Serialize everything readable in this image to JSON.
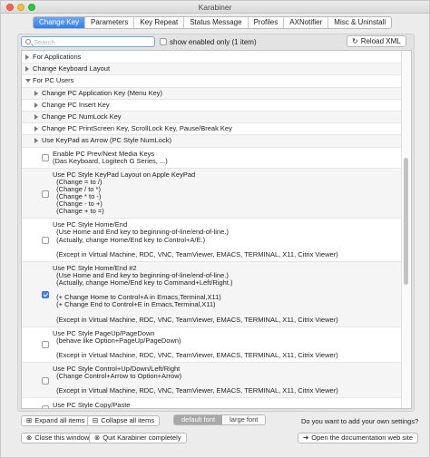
{
  "window": {
    "title": "Karabiner"
  },
  "tabs": [
    {
      "label": "Change Key",
      "active": true
    },
    {
      "label": "Parameters",
      "active": false
    },
    {
      "label": "Key Repeat",
      "active": false
    },
    {
      "label": "Status Message",
      "active": false
    },
    {
      "label": "Profiles",
      "active": false
    },
    {
      "label": "AXNotifier",
      "active": false
    },
    {
      "label": "Misc & Uninstall",
      "active": false
    }
  ],
  "search": {
    "placeholder": "Search",
    "value": ""
  },
  "show_enabled": {
    "label": "show enabled only (1 item)",
    "checked": false
  },
  "reload_button": {
    "label": "Reload XML",
    "icon": "refresh-icon"
  },
  "tree": [
    {
      "label": "For Applications",
      "type": "group",
      "expanded": false,
      "indent": 0
    },
    {
      "label": "Change Keyboard Layout",
      "type": "group",
      "expanded": false,
      "indent": 0
    },
    {
      "label": "For PC Users",
      "type": "group",
      "expanded": true,
      "indent": 0
    },
    {
      "label": "Change PC Application Key (Menu Key)",
      "type": "group",
      "expanded": false,
      "indent": 1
    },
    {
      "label": "Change PC Insert Key",
      "type": "group",
      "expanded": false,
      "indent": 1
    },
    {
      "label": "Change PC NumLock Key",
      "type": "group",
      "expanded": false,
      "indent": 1
    },
    {
      "label": "Change PC PrintScreen Key, ScrollLock Key, Pause/Break Key",
      "type": "group",
      "expanded": false,
      "indent": 1
    },
    {
      "label": "Use KeyPad as Arrow (PC Style NumLock)",
      "type": "group",
      "expanded": false,
      "indent": 1
    },
    {
      "label": "Enable PC Prev/Next Media Keys\n(Das Keyboard, Logitech G Series, ...)",
      "type": "option",
      "checked": false
    },
    {
      "label": "Use PC Style KeyPad Layout on Apple KeyPad\n  (Change = to /)\n  (Change / to *)\n  (Change * to -)\n  (Change - to +)\n  (Change + to =)",
      "type": "option",
      "checked": false
    },
    {
      "label": "Use PC Style Home/End\n  (Use Home and End key to beginning-of-line/end-of-line.)\n  (Actually, change Home/End key to Control+A/E.)\n\n  (Except in Virtual Machine, RDC, VNC, TeamViewer, EMACS, TERMINAL, X11, Citrix Viewer)",
      "type": "option",
      "checked": false
    },
    {
      "label": "Use PC Style Home/End #2\n  (Use Home and End key to beginning-of-line/end-of-line.)\n  (Actually, change Home/End key to Command+Left/Right.)\n\n  (+ Change Home to Control+A in Emacs,Terminal,X11)\n  (+ Change End to Control+E in Emacs,Terminal,X11)\n\n  (Except in Virtual Machine, RDC, VNC, TeamViewer, EMACS, TERMINAL, X11, Citrix Viewer)",
      "type": "option",
      "checked": true
    },
    {
      "label": "Use PC Style PageUp/PageDown\n  (behave like Option+PageUp/PageDown)\n\n  (Except in Virtual Machine, RDC, VNC, TeamViewer, EMACS, TERMINAL, X11, Citrix Viewer)",
      "type": "option",
      "checked": false
    },
    {
      "label": "Use PC Style Control+Up/Down/Left/Right\n  (Change Control+Arrow to Option+Arrow)\n\n  (Except in Virtual Machine, RDC, VNC, TeamViewer, EMACS, TERMINAL, X11, Citrix Viewer)",
      "type": "option",
      "checked": false
    },
    {
      "label": "Use PC Style Copy/Paste\n  (Control+C to Command_L+C)",
      "type": "option",
      "checked": false
    }
  ],
  "footer": {
    "expand_all": "Expand all items",
    "collapse_all": "Collapse all items",
    "font_default": "default font",
    "font_large": "large font",
    "own_settings_prompt": "Do you want to add your own settings?",
    "close_window": "Close this window",
    "quit": "Quit Karabiner completely",
    "documentation": "Open the documentation web site"
  },
  "colors": {
    "accent": "#2f7ef1",
    "checked": "#3d86f3"
  }
}
